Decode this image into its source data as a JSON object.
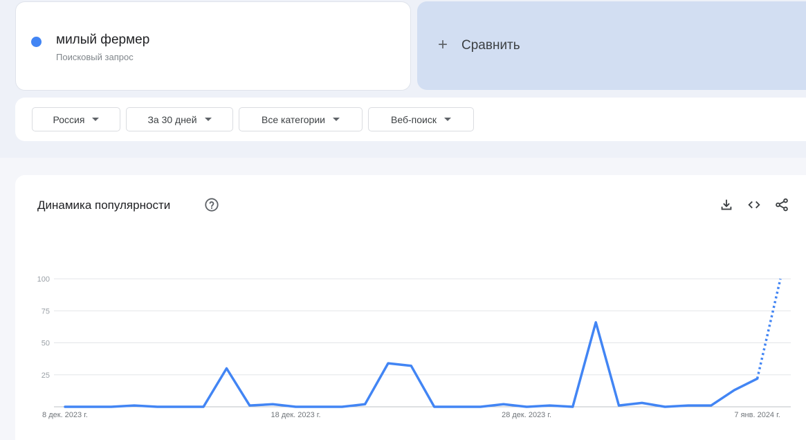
{
  "term": {
    "name": "милый фермер",
    "type": "Поисковый запрос",
    "color": "#4285f4"
  },
  "compare": {
    "label": "Сравнить",
    "icon": "plus-icon"
  },
  "filters": [
    {
      "label": "Россия",
      "icon": "caret-down-icon"
    },
    {
      "label": "За 30 дней",
      "icon": "caret-down-icon"
    },
    {
      "label": "Все категории",
      "icon": "caret-down-icon"
    },
    {
      "label": "Веб-поиск",
      "icon": "caret-down-icon"
    }
  ],
  "chart": {
    "title": "Динамика популярности",
    "help_icon": "help-circle-icon",
    "actions": [
      "download-icon",
      "embed-code-icon",
      "share-icon"
    ]
  },
  "chart_data": {
    "type": "line",
    "series": [
      {
        "color": "#4285f4",
        "x": [
          "8 дек. 2023 г.",
          "9 дек.",
          "10 дек.",
          "11 дек.",
          "12 дек.",
          "13 дек.",
          "14 дек.",
          "15 дек.",
          "16 дек.",
          "17 дек.",
          "18 дек. 2023 г.",
          "19 дек.",
          "20 дек.",
          "21 дек.",
          "22 дек.",
          "23 дек.",
          "24 дек.",
          "25 дек.",
          "26 дек.",
          "27 дек.",
          "28 дек. 2023 г.",
          "29 дек.",
          "30 дек.",
          "31 дек.",
          "1 янв.",
          "2 янв.",
          "3 янв.",
          "4 янв.",
          "5 янв.",
          "6 янв.",
          "7 янв. 2024 г.",
          "8 янв."
        ],
        "values": [
          0,
          0,
          0,
          1,
          0,
          0,
          0,
          30,
          1,
          2,
          0,
          0,
          0,
          2,
          34,
          32,
          0,
          0,
          0,
          2,
          0,
          1,
          0,
          66,
          1,
          3,
          0,
          1,
          1,
          13,
          22,
          100
        ],
        "partial_from_index": 30
      }
    ],
    "x_tick_labels": [
      "8 дек. 2023 г.",
      "18 дек. 2023 г.",
      "28 дек. 2023 г.",
      "7 янв. 2024 г."
    ],
    "x_tick_indices": [
      0,
      10,
      20,
      30
    ],
    "y_ticks": [
      25,
      50,
      75,
      100
    ],
    "ylim": [
      0,
      100
    ],
    "grid": true
  }
}
